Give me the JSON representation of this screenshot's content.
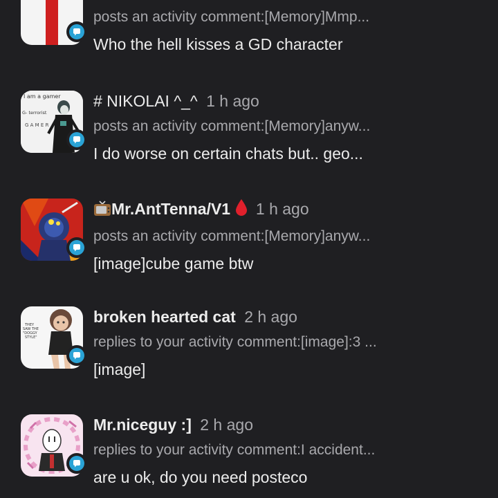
{
  "feed": {
    "items": [
      {
        "name": "",
        "time": "",
        "action": "posts an activity comment:[Memory]Mmp...",
        "message": "Who the hell kisses a GD character",
        "avatar_icon": "flag-avatar-icon"
      },
      {
        "name": "# NIKOLAI ^_^",
        "time": "1 h ago",
        "action": "posts an activity comment:[Memory]anyw...",
        "message": "I do worse on certain chats but.. geo...",
        "avatar_icon": "sketch-character-avatar-icon",
        "avatar_text": [
          "I am a gamer",
          "G- terrorist",
          "G A M E R"
        ]
      },
      {
        "name": "Mr.AntTenna/V1",
        "time": "1 h ago",
        "action": "posts an activity comment:[Memory]anyw...",
        "message": "[image]cube game btw",
        "avatar_icon": "robot-avatar-icon",
        "name_prefix_icon": "tv-icon",
        "name_suffix_icon": "blood-drop-icon"
      },
      {
        "name": "broken hearted cat",
        "time": "2 h ago",
        "action": "replies to your activity comment:[image]:3 ...",
        "message": "[image]",
        "avatar_icon": "cat-girl-avatar-icon",
        "avatar_text": [
          "THEY",
          "SAW THE",
          "\"DOGGY",
          "STYLE\""
        ]
      },
      {
        "name": "Mr.niceguy :]",
        "time": "2 h ago",
        "action": "replies to your activity comment:I accident...",
        "message": "are u ok, do you need posteco",
        "avatar_icon": "masked-character-avatar-icon"
      }
    ]
  },
  "colors": {
    "background": "#1f1f22",
    "primary_text": "#ececec",
    "secondary_text": "#a9a9ad",
    "badge": "#2aa3d6"
  }
}
